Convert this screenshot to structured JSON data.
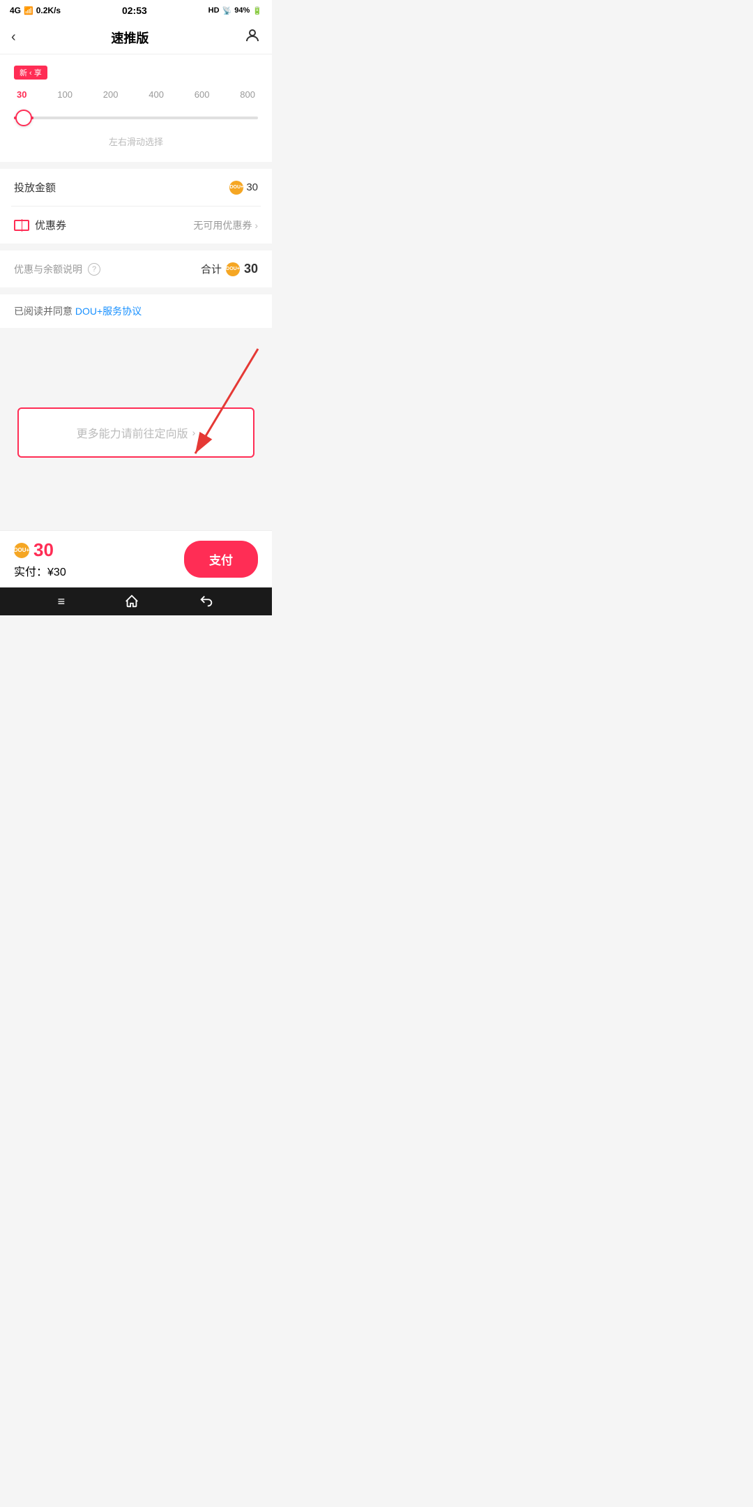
{
  "statusBar": {
    "network": "4G",
    "signal": "4G .ill",
    "speed": "0.2K/s",
    "time": "02:53",
    "hd": "HD",
    "wifi": "wifi",
    "battery": "94%"
  },
  "nav": {
    "title": "速推版",
    "backLabel": "‹",
    "userIcon": "user"
  },
  "slider": {
    "badgeText": "新 ‹ 享",
    "activeValue": "30",
    "ticks": [
      "30",
      "100",
      "200",
      "400",
      "600",
      "800"
    ],
    "hint": "左右滑动选择",
    "thumbPercent": 4
  },
  "investAmount": {
    "label": "投放金额",
    "value": "30",
    "coinLabel": "DOU+"
  },
  "coupon": {
    "label": "优惠券",
    "value": "无可用优惠券",
    "hasChevron": true
  },
  "summary": {
    "discountLabel": "优惠与余额说明",
    "helpIcon": "?",
    "totalLabel": "合计",
    "totalValue": "30",
    "coinLabel": "DOU+"
  },
  "agreement": {
    "prefix": "已阅读并同意 ",
    "linkText": "DOU+服务协议"
  },
  "moreBtn": {
    "text": "更多能力请前往定向版",
    "chevron": "›"
  },
  "bottomBar": {
    "coinValue": "30",
    "actualLabel": "实付：",
    "actualValue": "¥30",
    "payBtnLabel": "支付"
  },
  "navBottom": {
    "menuIcon": "≡",
    "homeIcon": "⌂",
    "backIcon": "↩"
  }
}
